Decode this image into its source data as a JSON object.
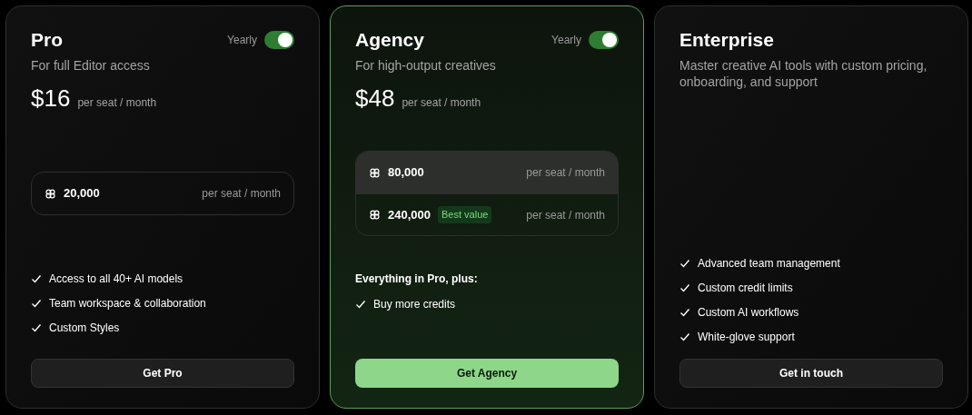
{
  "plans": [
    {
      "name": "Pro",
      "featured": false,
      "toggle": {
        "label": "Yearly",
        "on": true
      },
      "description": "For full Editor access",
      "price": "$16",
      "price_unit": "per seat / month",
      "credit_options": [
        {
          "amount": "20,000",
          "unit": "per seat / month",
          "selected": false
        }
      ],
      "features": [
        "Access to all 40+ AI models",
        "Team workspace & collaboration",
        "Custom Styles"
      ],
      "button": "Get Pro"
    },
    {
      "name": "Agency",
      "featured": true,
      "toggle": {
        "label": "Yearly",
        "on": true
      },
      "description": "For high-output creatives",
      "price": "$48",
      "price_unit": "per seat / month",
      "credit_options": [
        {
          "amount": "80,000",
          "unit": "per seat / month",
          "selected": true
        },
        {
          "amount": "240,000",
          "badge": "Best value",
          "unit": "per seat / month",
          "selected": false
        }
      ],
      "features_heading": "Everything in Pro, plus:",
      "features": [
        "Buy more credits"
      ],
      "button": "Get Agency"
    },
    {
      "name": "Enterprise",
      "featured": false,
      "description": "Master creative AI tools with custom pricing, onboarding, and support",
      "features": [
        "Advanced team management",
        "Custom credit limits",
        "Custom AI workflows",
        "White-glove support"
      ],
      "button": "Get in touch"
    }
  ]
}
